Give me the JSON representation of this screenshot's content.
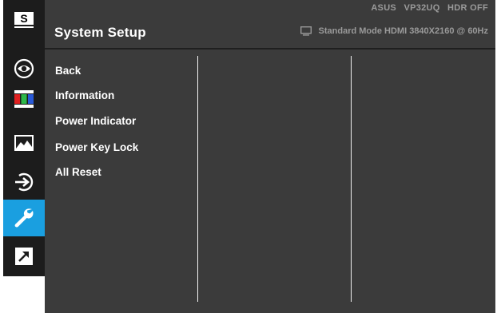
{
  "header": {
    "title": "System Setup",
    "model": "ASUS",
    "model_name": "VP32UQ",
    "hdr_status": "HDR OFF",
    "mode_info": "Standard Mode HDMI 3840X2160 @ 60Hz",
    "mode_icon": "monitor-icon"
  },
  "sidebar": {
    "items": [
      {
        "name": "splendid",
        "icon": "splendid-s-icon",
        "label": "S"
      },
      {
        "name": "eye-care",
        "icon": "eye-icon"
      },
      {
        "name": "color",
        "icon": "color-bars-icon"
      },
      {
        "name": "image",
        "icon": "mountain-image-icon"
      },
      {
        "name": "input-select",
        "icon": "input-arrow-icon"
      },
      {
        "name": "system-setup",
        "icon": "wrench-icon",
        "active": true
      },
      {
        "name": "shortcut",
        "icon": "shortcut-arrow-icon"
      }
    ]
  },
  "menu": {
    "items": [
      "Back",
      "Information",
      "Power Indicator",
      "Power Key Lock",
      "All Reset"
    ]
  },
  "colors": {
    "background": "#3b3b3b",
    "sidebar": "#1c1c1c",
    "active": "#1a9fe0",
    "text": "#ffffff",
    "muted": "#9a9a9a"
  }
}
